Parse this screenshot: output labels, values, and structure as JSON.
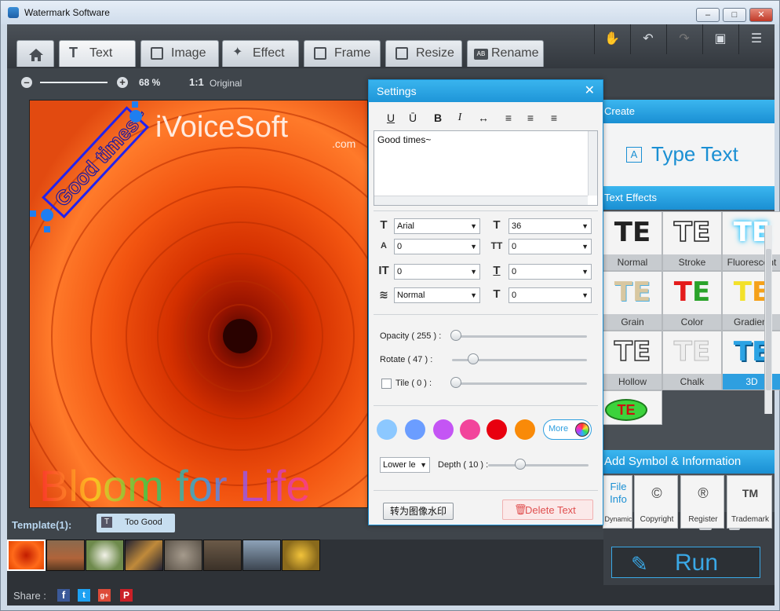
{
  "window": {
    "title": "Watermark Software",
    "min": "–",
    "max": "□",
    "close": "✕"
  },
  "tabs": [
    {
      "label": ""
    },
    {
      "label": "Text"
    },
    {
      "label": "Image"
    },
    {
      "label": "Effect"
    },
    {
      "label": "Frame"
    },
    {
      "label": "Resize"
    },
    {
      "label": "Rename"
    }
  ],
  "zoom": {
    "percent": "68 %",
    "original_prefix": "1:1",
    "original_label": "Original"
  },
  "canvas": {
    "brand_text": "iVoiceSoft",
    "brand_domain": ".com",
    "watermark_text": "Good times~",
    "bottom_text": "Bloom for Life"
  },
  "template": {
    "label": "Template(1):",
    "item": "Too Good"
  },
  "share": {
    "label": "Share :",
    "icons": [
      "f",
      "t",
      "g+",
      "P"
    ]
  },
  "run": {
    "label": "Run"
  },
  "right_panel": {
    "create_header": "Create",
    "type_text": "Type Text",
    "effects_header": "Text Effects",
    "effect_glyph": "TE",
    "effects": [
      "Normal",
      "Stroke",
      "Fluorescent",
      "Grain",
      "Color",
      "Gradient",
      "Hollow",
      "Chalk",
      "3D"
    ],
    "symbol_header": "Add Symbol & Information",
    "symbols": [
      {
        "top": "File Info",
        "label": "Dynamic"
      },
      {
        "top": "©",
        "label": "Copyright"
      },
      {
        "top": "®",
        "label": "Register"
      },
      {
        "top": "TM",
        "label": "Trademark"
      }
    ]
  },
  "settings": {
    "title": "Settings",
    "close": "✕",
    "format_buttons": [
      "U",
      "Ū",
      "B",
      "I"
    ],
    "text_value": "Good times~",
    "font": "Arial",
    "size": "36",
    "char_spacing": "0",
    "line_spacing": "0",
    "vertical_offset": "0",
    "shadow": "0",
    "blend": "Normal",
    "outline": "0",
    "opacity_label": "Opacity ( 255 ) :",
    "opacity": 255,
    "rotate_label": "Rotate ( 47 ) :",
    "rotate": 47,
    "tile_label": "Tile ( 0 ) :",
    "tile": 0,
    "colors": [
      "#8cc8ff",
      "#6b9dff",
      "#c455f4",
      "#f2449b",
      "#e8000f",
      "#f98a08"
    ],
    "more_label": "More",
    "direction": "Lower le",
    "depth_label": "Depth ( 10 ) :",
    "depth": 10,
    "convert_button": "转为图像水印",
    "delete_button": "Delete Text"
  }
}
